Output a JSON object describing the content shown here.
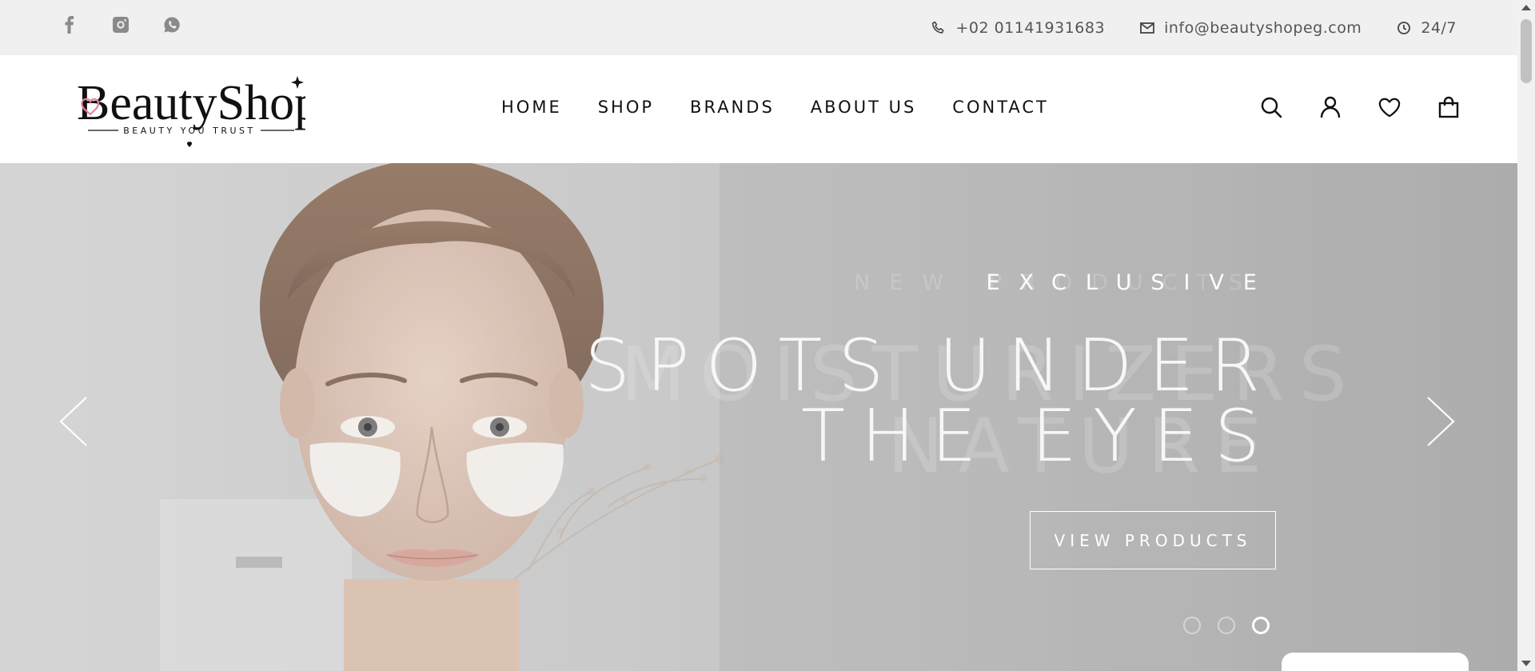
{
  "topbar": {
    "social": [
      {
        "icon": "facebook-icon"
      },
      {
        "icon": "instagram-icon"
      },
      {
        "icon": "whatsapp-icon"
      }
    ],
    "phone": "+02 01141931683",
    "email": "info@beautyshopeg.com",
    "hours": "24/7"
  },
  "logo": {
    "wordmark": "BeautyShop",
    "tagline": "BEAUTY YOU TRUST"
  },
  "nav": [
    "HOME",
    "SHOP",
    "BRANDS",
    "ABOUT US",
    "CONTACT"
  ],
  "header_icons": [
    "search-icon",
    "account-icon",
    "wishlist-heart-icon",
    "cart-bag-icon"
  ],
  "hero": {
    "eyebrow": "EXCLUSIVE",
    "headline_line1": "SPOTS UNDER",
    "headline_line2": "THE EYES",
    "cta": "VIEW PRODUCTS",
    "ghost_eyebrow": "NEW PRODUCTS",
    "ghost_line1": "MOISTURIZERS",
    "ghost_line2": "NATURE",
    "slide_count": 3,
    "active_slide": 3
  },
  "colors": {
    "topbar_bg": "#f0f0f0",
    "hero_text": "#ffffff",
    "nav_text": "#111111",
    "logo_heart": "#e7849b"
  }
}
